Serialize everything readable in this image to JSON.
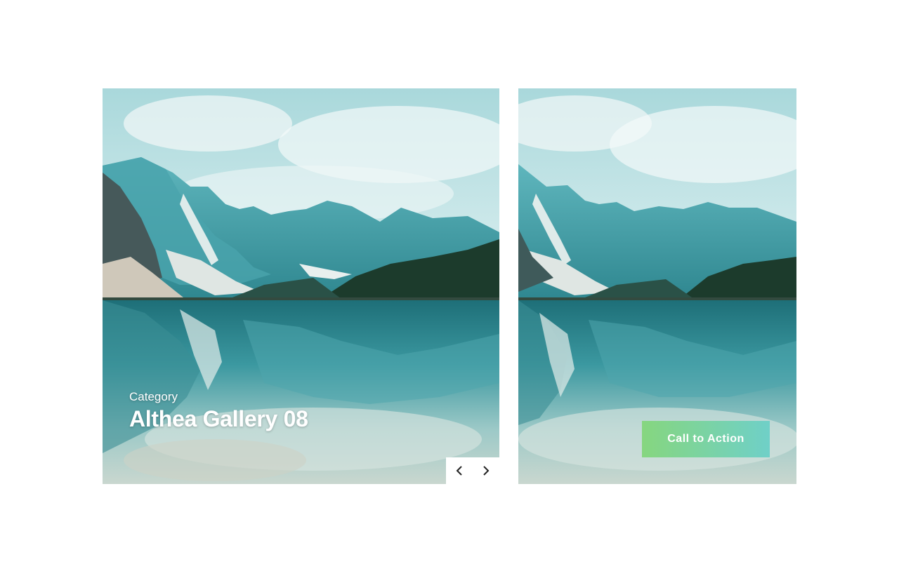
{
  "gallery": {
    "category": "Category",
    "title": "Althea Gallery 08",
    "prev_icon": "chevron-left-icon",
    "next_icon": "chevron-right-icon",
    "cta_label": "Call to Action",
    "colors": {
      "cta_start": "#86d67f",
      "cta_end": "#6fd0c8",
      "sky": "#d7ecee",
      "water": "#2f8f96"
    }
  }
}
